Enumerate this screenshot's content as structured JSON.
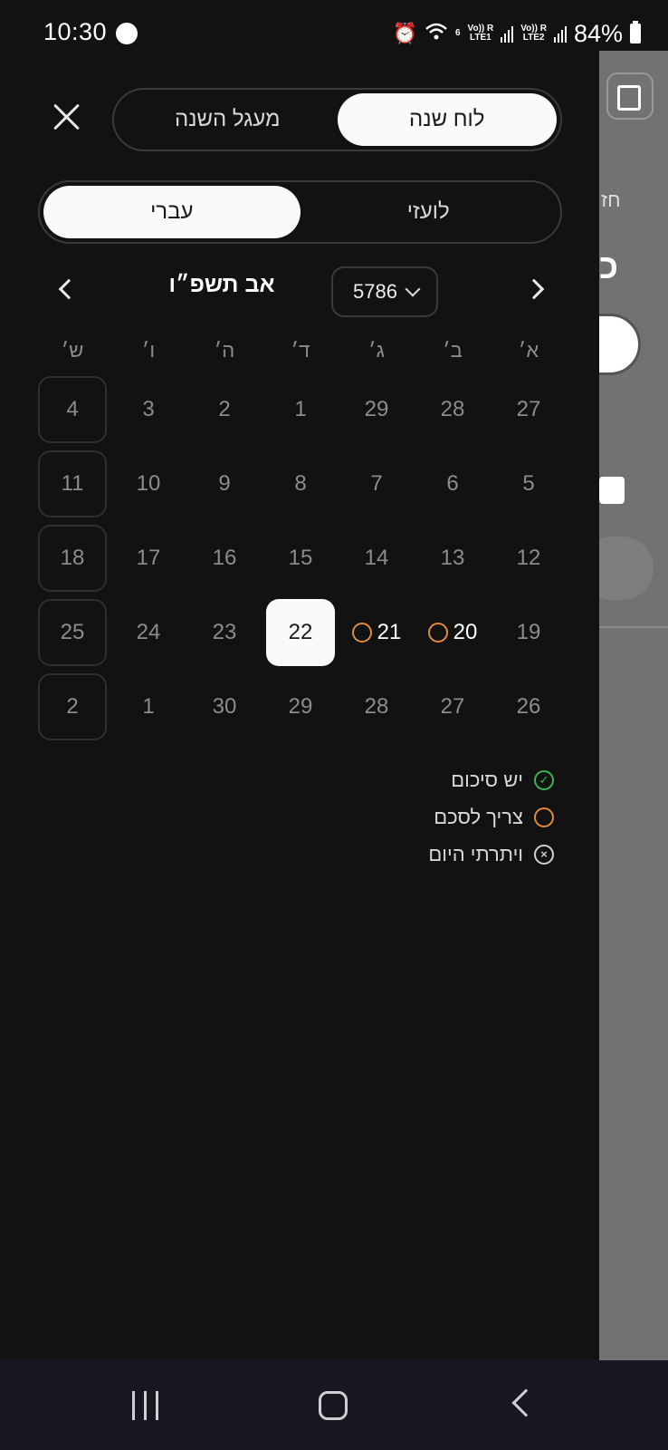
{
  "status_bar": {
    "time": "10:30",
    "wifi_label": "6",
    "sim1_top": "Vo)) R",
    "sim1_bottom": "LTE1",
    "sim2_top": "Vo)) R",
    "sim2_bottom": "LTE2",
    "battery": "84%"
  },
  "background_app": {
    "text_1": "חז",
    "text_2": "כ"
  },
  "drawer": {
    "top_tabs": [
      {
        "label": "לוח שנה",
        "active": true
      },
      {
        "label": "מעגל השנה",
        "active": false
      }
    ],
    "calendar_tabs": [
      {
        "label": "לועזי",
        "active": false
      },
      {
        "label": "עברי",
        "active": true
      }
    ],
    "month_title": "אב תשפ״ו",
    "year": "5786"
  },
  "calendar": {
    "weekdays": [
      "א׳",
      "ב׳",
      "ג׳",
      "ד׳",
      "ה׳",
      "ו׳",
      "ש׳"
    ],
    "weeks": [
      [
        "27",
        "28",
        "29",
        "1",
        "2",
        "3",
        "4"
      ],
      [
        "5",
        "6",
        "7",
        "8",
        "9",
        "10",
        "11"
      ],
      [
        "12",
        "13",
        "14",
        "15",
        "16",
        "17",
        "18"
      ],
      [
        "19",
        "20",
        "21",
        "22",
        "23",
        "24",
        "25"
      ],
      [
        "26",
        "27",
        "28",
        "29",
        "30",
        "1",
        "2"
      ]
    ],
    "today": "22",
    "needs_summary_days": [
      "20",
      "21"
    ],
    "status_colors": {
      "has_summary": "#35b553",
      "needs_summary": "#e08a3c",
      "gave_up": "#cfcfcf"
    }
  },
  "legend": [
    {
      "label": "יש סיכום",
      "icon": "check-circle-icon"
    },
    {
      "label": "צריך לסכם",
      "icon": "empty-circle-icon"
    },
    {
      "label": "ויתרתי היום",
      "icon": "x-circle-icon"
    }
  ]
}
